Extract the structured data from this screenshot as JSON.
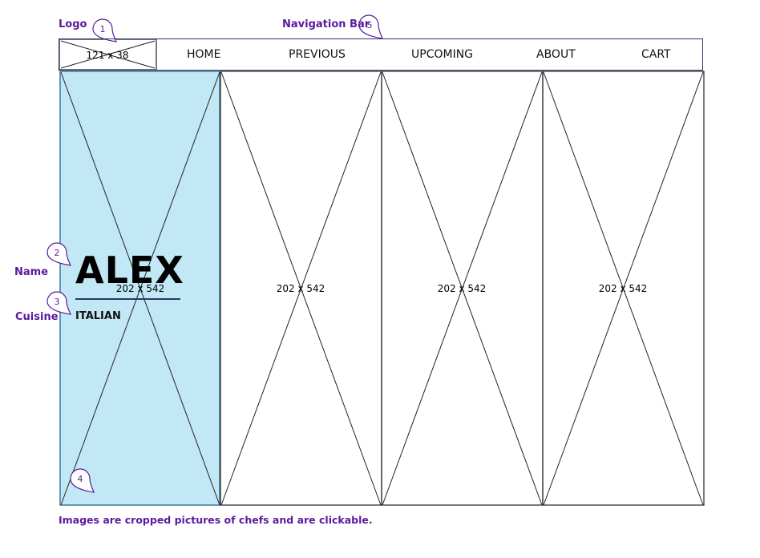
{
  "annotations": {
    "logo": "Logo",
    "navigation_bar": "Navigation Bar",
    "name": "Name",
    "cuisine": "Cuisine",
    "footer_note": "Images are cropped pictures of chefs and are clickable."
  },
  "markers": [
    "1",
    "2",
    "3",
    "4",
    "5"
  ],
  "logo_placeholder": "121 x 38",
  "nav_items": [
    "HOME",
    "PREVIOUS",
    "UPCOMING",
    "ABOUT",
    "CART"
  ],
  "image_placeholders": [
    "202 x 542",
    "202 x 542",
    "202 x 542",
    "202 x 542"
  ],
  "featured_chef": {
    "name": "ALEX",
    "cuisine": "ITALIAN"
  },
  "colors": {
    "annotation": "#5a1a9e",
    "highlight_fill": "#c2e8f5",
    "outline": "#2a3a66"
  }
}
